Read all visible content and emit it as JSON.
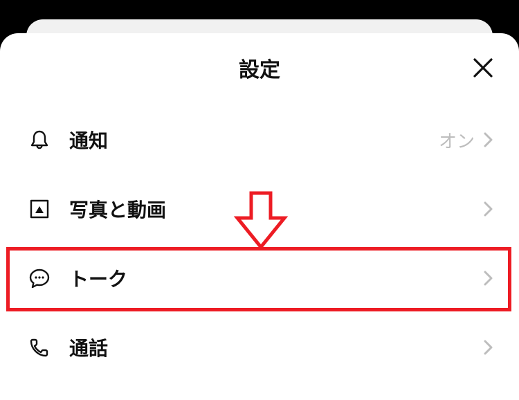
{
  "header": {
    "title": "設定"
  },
  "items": [
    {
      "icon": "bell",
      "label": "通知",
      "value": "オン"
    },
    {
      "icon": "image",
      "label": "写真と動画",
      "value": ""
    },
    {
      "icon": "chat",
      "label": "トーク",
      "value": ""
    },
    {
      "icon": "phone",
      "label": "通話",
      "value": ""
    }
  ],
  "annotation": {
    "highlight_index": 2,
    "arrow_color": "#ed1c24"
  }
}
